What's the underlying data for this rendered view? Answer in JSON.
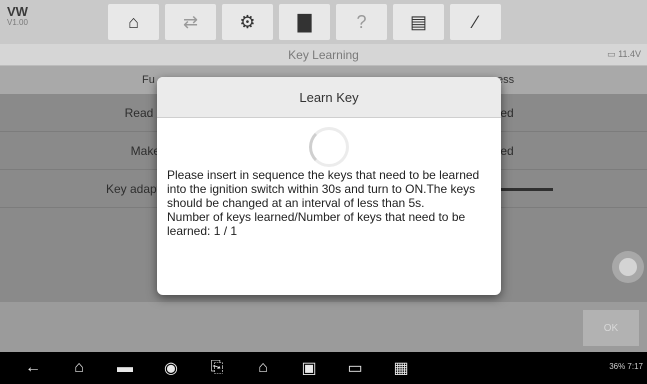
{
  "header": {
    "make": "VW",
    "version": "V1.00",
    "toolbar": [
      {
        "icon": "home-icon",
        "glyph": "⌂",
        "dim": false
      },
      {
        "icon": "vehicle-swap-icon",
        "glyph": "⇄",
        "dim": true
      },
      {
        "icon": "settings-gear-icon",
        "glyph": "⚙",
        "dim": false
      },
      {
        "icon": "print-icon",
        "glyph": "▇",
        "dim": false
      },
      {
        "icon": "help-icon",
        "glyph": "?",
        "dim": true
      },
      {
        "icon": "save-icon",
        "glyph": "▤",
        "dim": false
      },
      {
        "icon": "pen-edit-icon",
        "glyph": "∕",
        "dim": false
      }
    ]
  },
  "titlebar": {
    "title": "Key Learning",
    "battery": "11.4V"
  },
  "table": {
    "col_function": "Fu",
    "col_status": "ess",
    "rows": [
      {
        "name": "Read I",
        "status": "ted"
      },
      {
        "name": "Make",
        "status": "ted"
      },
      {
        "name": "Key adapt",
        "status": "",
        "progress": true
      }
    ]
  },
  "footer": {
    "ok_label": "OK"
  },
  "navbar": {
    "icons": [
      "back-icon",
      "home-icon",
      "recent-apps-icon",
      "browser-icon",
      "remote-icon",
      "autel-home-icon",
      "vci-icon",
      "car-icon",
      "shop-icon"
    ],
    "glyphs": [
      "←",
      "⌂",
      "▬",
      "◉",
      "⎘",
      "⌂",
      "▣",
      "▭",
      "▦"
    ],
    "status": "36%  7:17"
  },
  "modal": {
    "title": "Learn Key",
    "message": "Please insert in sequence the keys that need to be learned into the ignition switch within 30s and turn to ON.The keys should be changed at an interval of less than 5s.",
    "progress_text": "Number of keys learned/Number of keys that need to be learned: 1 / 1"
  }
}
